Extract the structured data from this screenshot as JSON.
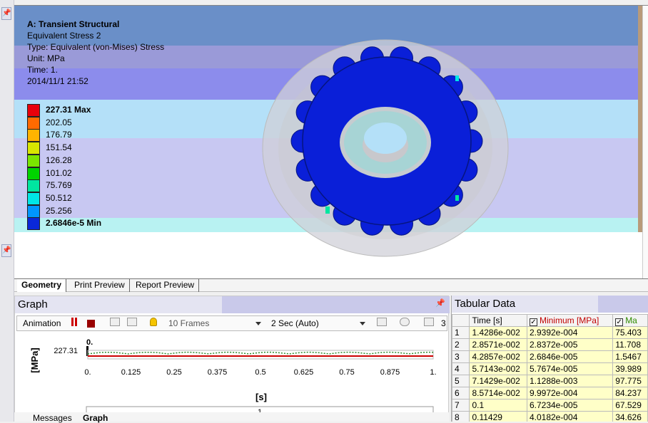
{
  "viewport": {
    "title": "A: Transient Structural",
    "result_name": "Equivalent Stress 2",
    "type_line": "Type: Equivalent (von-Mises) Stress",
    "unit_line": "Unit: MPa",
    "time_line": "Time: 1.",
    "timestamp": "2014/11/1 21:52",
    "legend": [
      {
        "label": "227.31 Max",
        "color": "#e8000b",
        "bold": true
      },
      {
        "label": "202.05",
        "color": "#ff6a00",
        "bold": false
      },
      {
        "label": "176.79",
        "color": "#ffb400",
        "bold": false
      },
      {
        "label": "151.54",
        "color": "#d8e600",
        "bold": false
      },
      {
        "label": "126.28",
        "color": "#7ae600",
        "bold": false
      },
      {
        "label": "101.02",
        "color": "#00d400",
        "bold": false
      },
      {
        "label": "75.769",
        "color": "#00e6a0",
        "bold": false
      },
      {
        "label": "50.512",
        "color": "#00e6e6",
        "bold": false
      },
      {
        "label": "25.256",
        "color": "#0096ff",
        "bold": false
      },
      {
        "label": "2.6846e-5 Min",
        "color": "#0a28d8",
        "bold": true
      }
    ]
  },
  "view_tabs": [
    "Geometry",
    "Print Preview",
    "Report Preview"
  ],
  "graph": {
    "title": "Graph",
    "toolbar": {
      "animation_label": "Animation",
      "frames_value": "10 Frames",
      "duration_value": "2 Sec (Auto)",
      "extra_value": "3"
    },
    "y_axis_label": "[MPa]",
    "y_tick": "227.31",
    "x_axis_label": "[s]",
    "x_ticks": [
      "0.",
      "0.125",
      "0.25",
      "0.375",
      "0.5",
      "0.625",
      "0.75",
      "0.875",
      "1."
    ],
    "top_marker": "0.",
    "frame_field_value": "1"
  },
  "bottom_tabs": [
    "Messages",
    "Graph"
  ],
  "tabular": {
    "title": "Tabular Data",
    "headers": [
      "Time [s]",
      "Minimum [MPa]",
      "Ma"
    ],
    "rows": [
      {
        "i": "1",
        "time": "1.4286e-002",
        "min": "2.9392e-004",
        "max": "75.403"
      },
      {
        "i": "2",
        "time": "2.8571e-002",
        "min": "2.8372e-005",
        "max": "11.708"
      },
      {
        "i": "3",
        "time": "4.2857e-002",
        "min": "2.6846e-005",
        "max": "1.5467"
      },
      {
        "i": "4",
        "time": "5.7143e-002",
        "min": "5.7674e-005",
        "max": "39.989"
      },
      {
        "i": "5",
        "time": "7.1429e-002",
        "min": "1.1288e-003",
        "max": "97.775"
      },
      {
        "i": "6",
        "time": "8.5714e-002",
        "min": "9.9972e-004",
        "max": "84.237"
      },
      {
        "i": "7",
        "time": "0.1",
        "min": "6.7234e-005",
        "max": "67.529"
      },
      {
        "i": "8",
        "time": "0.11429",
        "min": "4.0182e-004",
        "max": "34.626"
      }
    ]
  },
  "colors": {
    "minimum_header": "#c00000",
    "max_header": "#2e8b00",
    "panel_header": "#e4e4f2",
    "panel_header_accent": "#c9c9ea"
  }
}
